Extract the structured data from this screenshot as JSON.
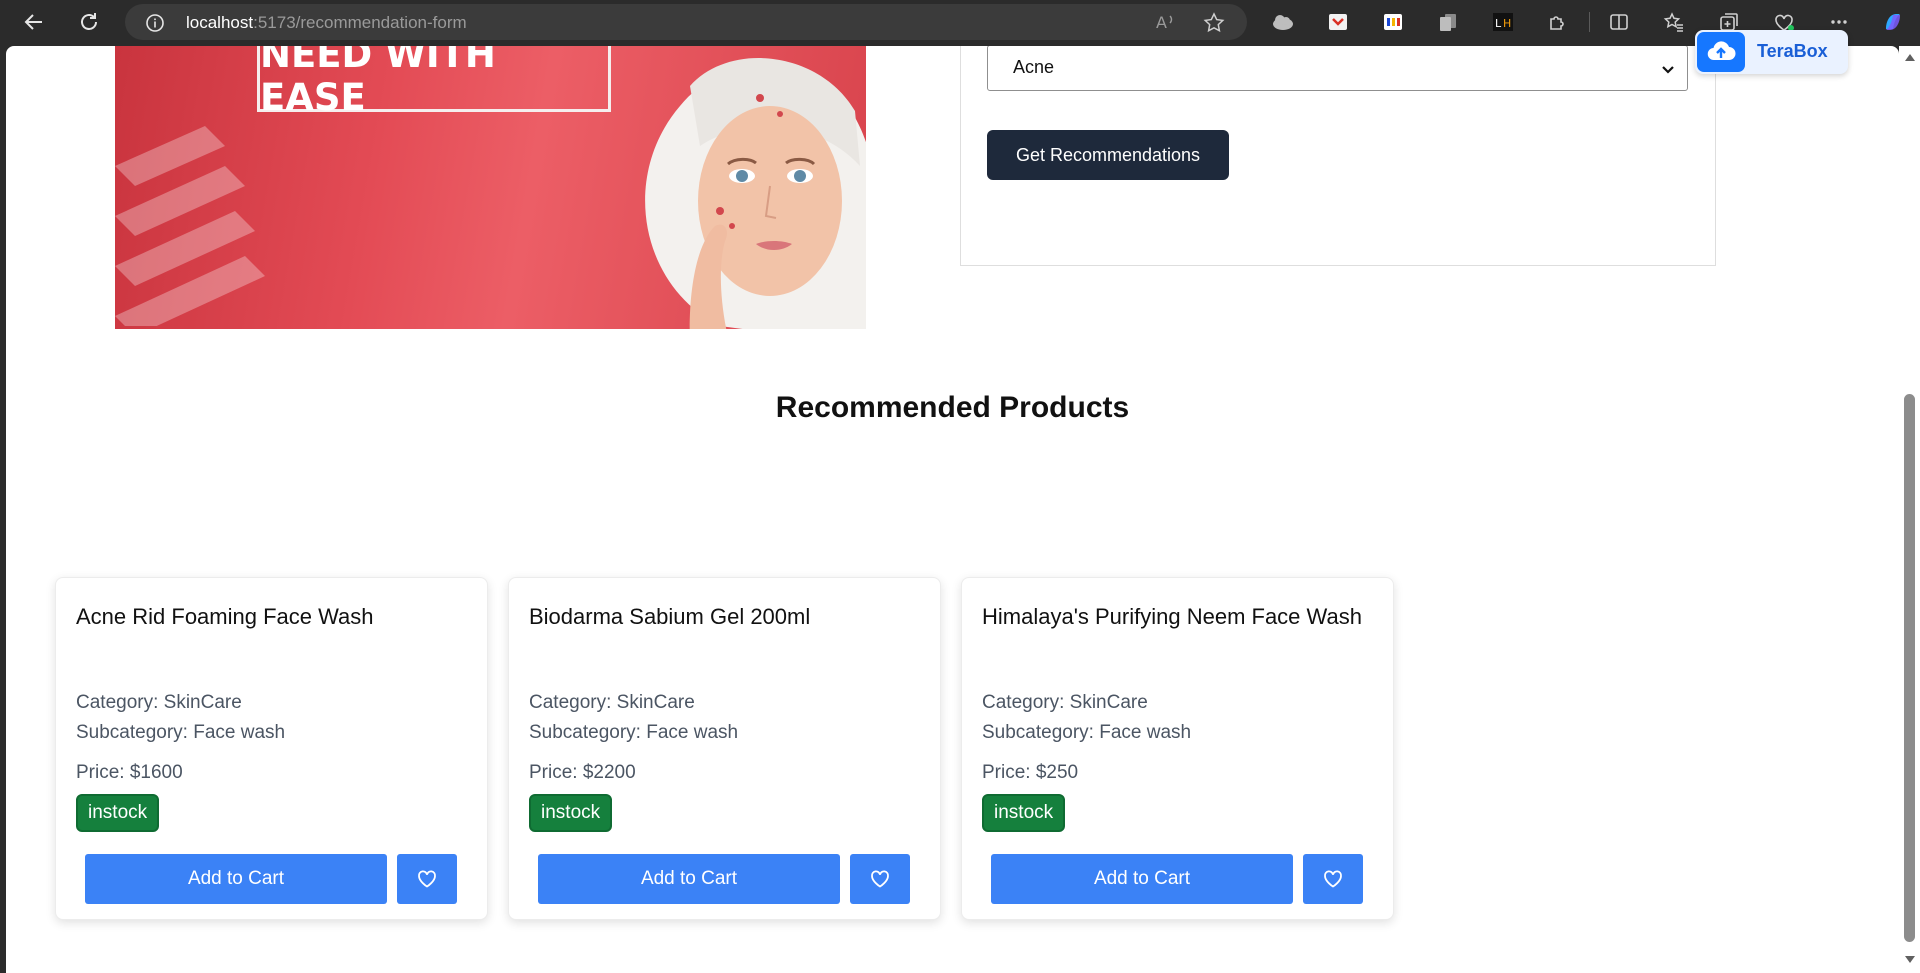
{
  "browser": {
    "url_host": "localhost",
    "url_path": ":5173/recommendation-form"
  },
  "banner": {
    "headline": "NEED WITH EASE"
  },
  "form": {
    "selected_concern": "Acne",
    "submit_label": "Get Recommendations"
  },
  "section_title": "Recommended Products",
  "products": [
    {
      "name": "Acne Rid Foaming Face Wash",
      "category": "Category: SkinCare",
      "subcategory": "Subcategory: Face wash",
      "price": "Price: $1600",
      "stock": "instock",
      "add_label": "Add to Cart"
    },
    {
      "name": "Biodarma Sabium Gel 200ml",
      "category": "Category: SkinCare",
      "subcategory": "Subcategory: Face wash",
      "price": "Price: $2200",
      "stock": "instock",
      "add_label": "Add to Cart"
    },
    {
      "name": "Himalaya's Purifying Neem Face Wash",
      "category": "Category: SkinCare",
      "subcategory": "Subcategory: Face wash",
      "price": "Price: $250",
      "stock": "instock",
      "add_label": "Add to Cart"
    }
  ],
  "extension": {
    "label": "TeraBox"
  },
  "colors": {
    "primary_button": "#3b82f6",
    "dark_button": "#1e293b",
    "stock_badge": "#15803d",
    "banner_red": "#e34b55"
  },
  "icons": [
    "back-icon",
    "refresh-icon",
    "info-icon",
    "read-aloud-icon",
    "favorite-star-icon",
    "heart-icon",
    "chevron-down-icon",
    "upload-cloud-icon"
  ]
}
